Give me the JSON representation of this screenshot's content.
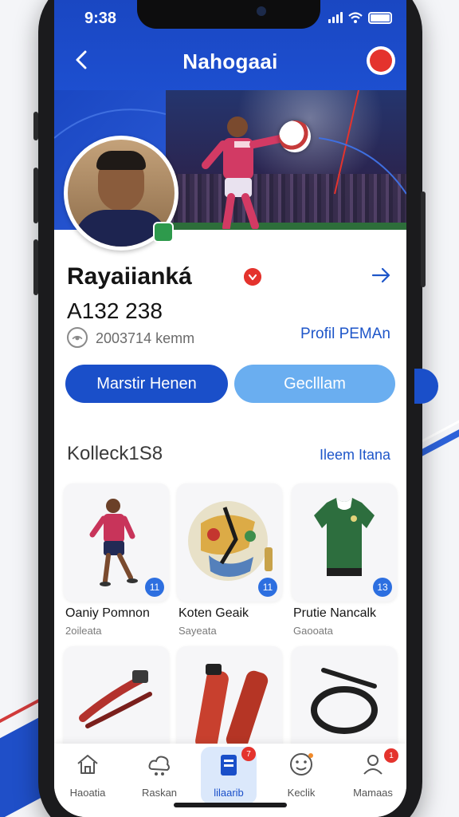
{
  "status_bar": {
    "time": "9:38"
  },
  "header": {
    "title": "Nahogaai"
  },
  "profile": {
    "name": "Rayaiianká",
    "player_id": "A132 238",
    "location": "2003714 kemm",
    "profile_link": "Profil PEMAn"
  },
  "actions": {
    "primary_label": "Marstir Henen",
    "secondary_label": "Geclllam"
  },
  "collection": {
    "title": "Kolleck1S8",
    "link": "Ileem Itana",
    "items": [
      {
        "title": "Oaniy Pomnon",
        "sub": "2oileata",
        "count": "11"
      },
      {
        "title": "Koten Geaik",
        "sub": "Sayeata",
        "count": "11"
      },
      {
        "title": "Prutie Nancalk",
        "sub": "Gaooata",
        "count": "13"
      }
    ]
  },
  "bottom_nav": {
    "items": [
      {
        "label": "Haoatia",
        "badge": ""
      },
      {
        "label": "Raskan",
        "badge": ""
      },
      {
        "label": "lilaarib",
        "badge": "7"
      },
      {
        "label": "Keclik",
        "badge": ""
      },
      {
        "label": "Mamaas",
        "badge": "1"
      }
    ]
  },
  "colors": {
    "brand_blue": "#1a4fc9",
    "light_blue": "#6aaef0",
    "accent_red": "#e4332d",
    "link_blue": "#1e56c9"
  }
}
